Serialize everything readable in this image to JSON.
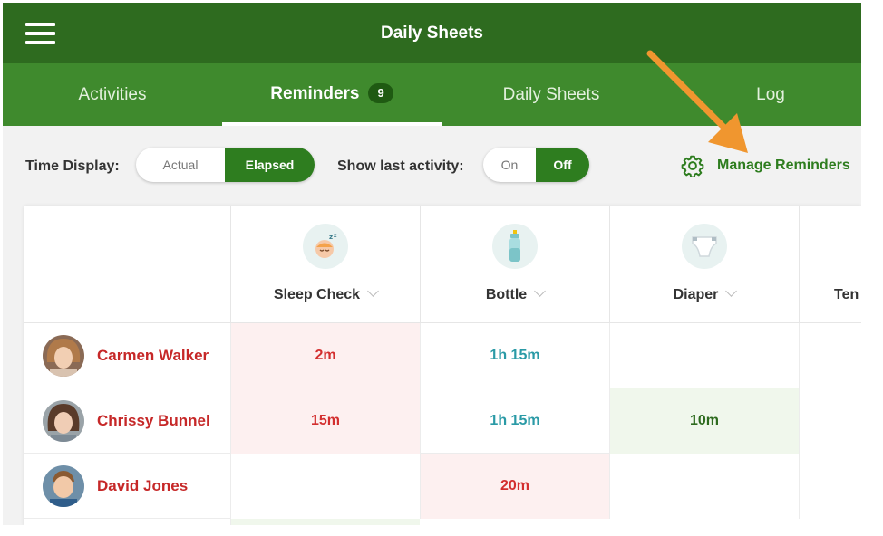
{
  "app": {
    "title": "Daily Sheets"
  },
  "tabs": [
    {
      "label": "Activities"
    },
    {
      "label": "Reminders",
      "badge": "9"
    },
    {
      "label": "Daily Sheets"
    },
    {
      "label": "Log"
    }
  ],
  "controls": {
    "time_display_label": "Time Display:",
    "time_display_options": [
      "Actual",
      "Elapsed"
    ],
    "time_display_selected": "Elapsed",
    "show_last_label": "Show last activity:",
    "show_last_options": [
      "On",
      "Off"
    ],
    "show_last_selected": "Off",
    "manage_label": "Manage Reminders"
  },
  "columns": [
    {
      "label": "Sleep Check",
      "icon": "sleeping-baby-icon"
    },
    {
      "label": "Bottle",
      "icon": "baby-bottle-icon"
    },
    {
      "label": "Diaper",
      "icon": "diaper-icon"
    },
    {
      "label": "Ten"
    }
  ],
  "rows": [
    {
      "name": "Carmen Walker",
      "cells": [
        "2m",
        "1h 15m",
        "",
        ""
      ]
    },
    {
      "name": "Chrissy Bunnel",
      "cells": [
        "15m",
        "1h 15m",
        "10m",
        ""
      ]
    },
    {
      "name": "David Jones",
      "cells": [
        "",
        "20m",
        "",
        ""
      ]
    }
  ],
  "colors": {
    "header": "#2e6b1f",
    "tabs": "#3f8a2d",
    "accent": "#2e7d1f",
    "alert": "#d32f2f",
    "arrow": "#f0962f"
  }
}
